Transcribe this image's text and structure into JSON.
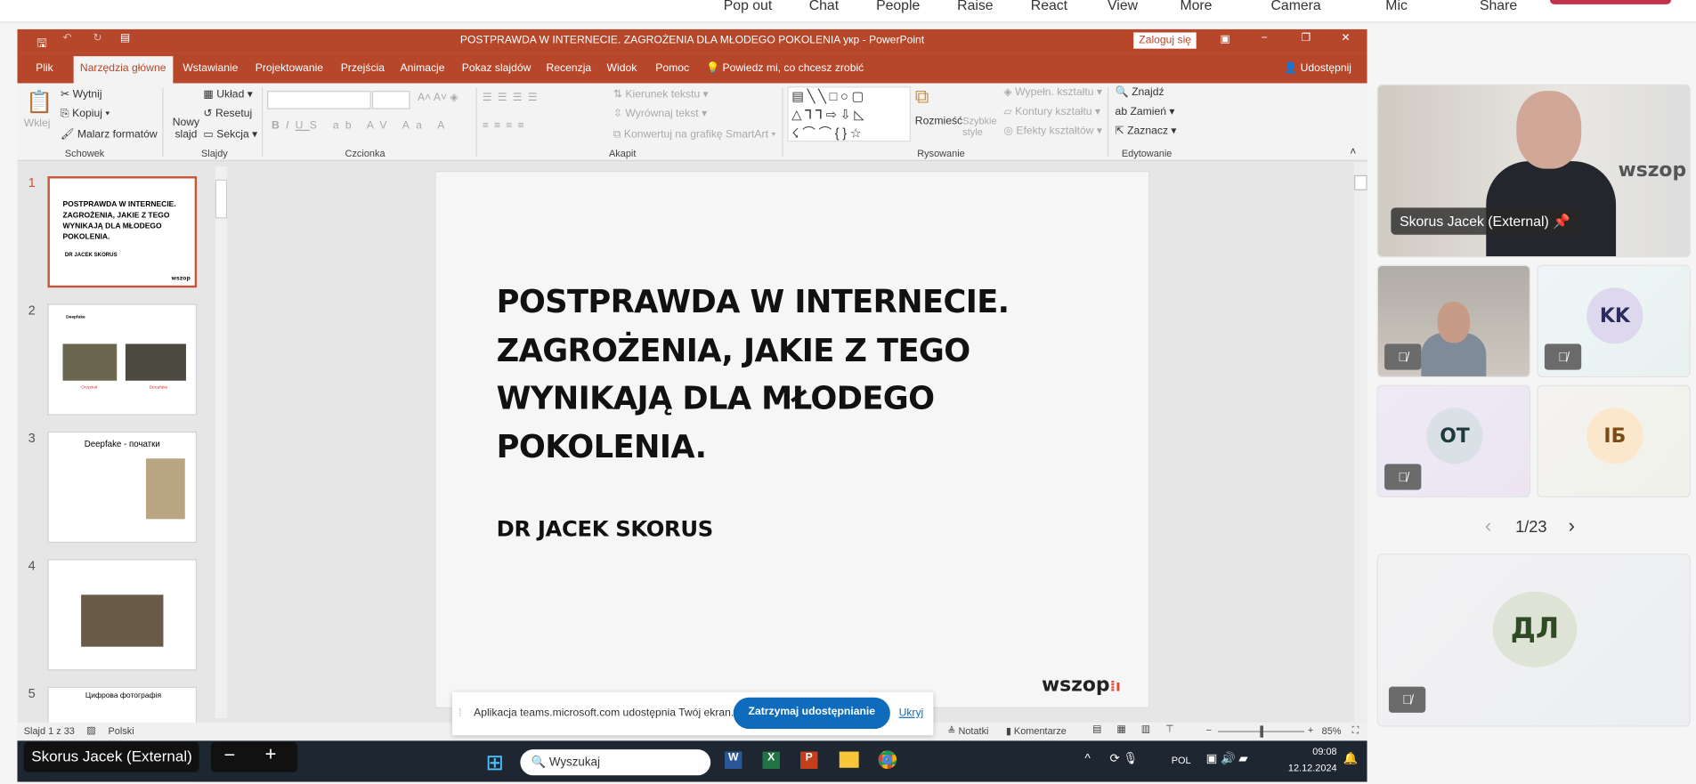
{
  "teams": {
    "toolbar": [
      "Pop out",
      "Chat",
      "People",
      "Raise",
      "React",
      "View",
      "More",
      "Camera",
      "Mic",
      "Share"
    ]
  },
  "ppt": {
    "title": "POSTPRAWDA W INTERNECIE. ZAGROŻENIA DLA MŁODEGO POKOLENIA укр  -  PowerPoint",
    "signin": "Zaloguj się",
    "tabs": [
      "Plik",
      "Narzędzia główne",
      "Wstawianie",
      "Projektowanie",
      "Przejścia",
      "Animacje",
      "Pokaz slajdów",
      "Recenzja",
      "Widok",
      "Pomoc"
    ],
    "tell_me": "Powiedz mi, co chcesz zrobić",
    "share": "Udostępnij",
    "ribbon": {
      "paste": "Wklej",
      "cut": "Wytnij",
      "copy": "Kopiuj",
      "format_painter": "Malarz formatów",
      "new_slide": "Nowy slajd",
      "layout": "Układ",
      "reset": "Resetuj",
      "section": "Sekcja",
      "text_direction": "Kierunek tekstu",
      "align_text": "Wyrównaj tekst",
      "smartart": "Konwertuj na grafikę SmartArt",
      "arrange": "Rozmieść",
      "quick_styles": "Szybkie style",
      "shape_fill": "Wypełn. kształtu",
      "shape_outline": "Kontury kształtu",
      "shape_effects": "Efekty kształtów",
      "find": "Znajdź",
      "replace": "Zamień",
      "select": "Zaznacz",
      "groups": [
        "Schowek",
        "Slajdy",
        "Czcionka",
        "Akapit",
        "Rysowanie",
        "Edytowanie"
      ]
    },
    "thumbnails": [
      {
        "num": "1",
        "title": "POSTPRAWDA W INTERNECIE. ZAGROŻENIA, JAKIE Z TEGO WYNIKAJĄ DLA MŁODEGO POKOLENIA.",
        "sub": "DR JACEK SKORUS"
      },
      {
        "num": "2",
        "title": "Deepfake",
        "labels": [
          "Oryginał",
          "Deepfake"
        ]
      },
      {
        "num": "3",
        "title": "Deepfake - початки"
      },
      {
        "num": "4",
        "title": ""
      },
      {
        "num": "5",
        "title": "Цифрова фотографія"
      }
    ],
    "slide": {
      "title_lines": [
        "POSTPRAWDA W INTERNECIE.",
        "ZAGROŻENIA, JAKIE Z TEGO",
        "WYNIKAJĄ DLA MŁODEGO",
        "POKOLENIA."
      ],
      "author": "DR JACEK SKORUS",
      "logo": "wszop"
    },
    "status": {
      "slide": "Slajd 1 z 33",
      "language": "Polski",
      "notes": "Notatki",
      "comments": "Komentarze",
      "zoom": "85%",
      "zoom_fraction": 0.5
    }
  },
  "share_banner": {
    "text": "Aplikacja teams.microsoft.com udostępnia Twój ekran.",
    "stop": "Zatrzymaj udostępnianie",
    "hide": "Ukryj"
  },
  "presenter_overlay": {
    "name": "Skorus Jacek (External)",
    "minus": "−",
    "plus": "+"
  },
  "taskbar": {
    "search": "Wyszukaj",
    "lang": "POL",
    "time": "09:08",
    "date": "12.12.2024"
  },
  "participants": {
    "main": {
      "name": "Skorus Jacek (External)"
    },
    "tiles": [
      {
        "initials": "",
        "muted": true
      },
      {
        "initials": "KK",
        "muted": true,
        "color": "#ddd8ee"
      },
      {
        "initials": "OT",
        "muted": true,
        "color": "#d9e1e6"
      },
      {
        "initials": "ІБ",
        "muted": false,
        "color": "#fbe7cc"
      }
    ],
    "pager": "1/23",
    "bottom": {
      "initials": "ДЛ",
      "muted": true
    }
  }
}
